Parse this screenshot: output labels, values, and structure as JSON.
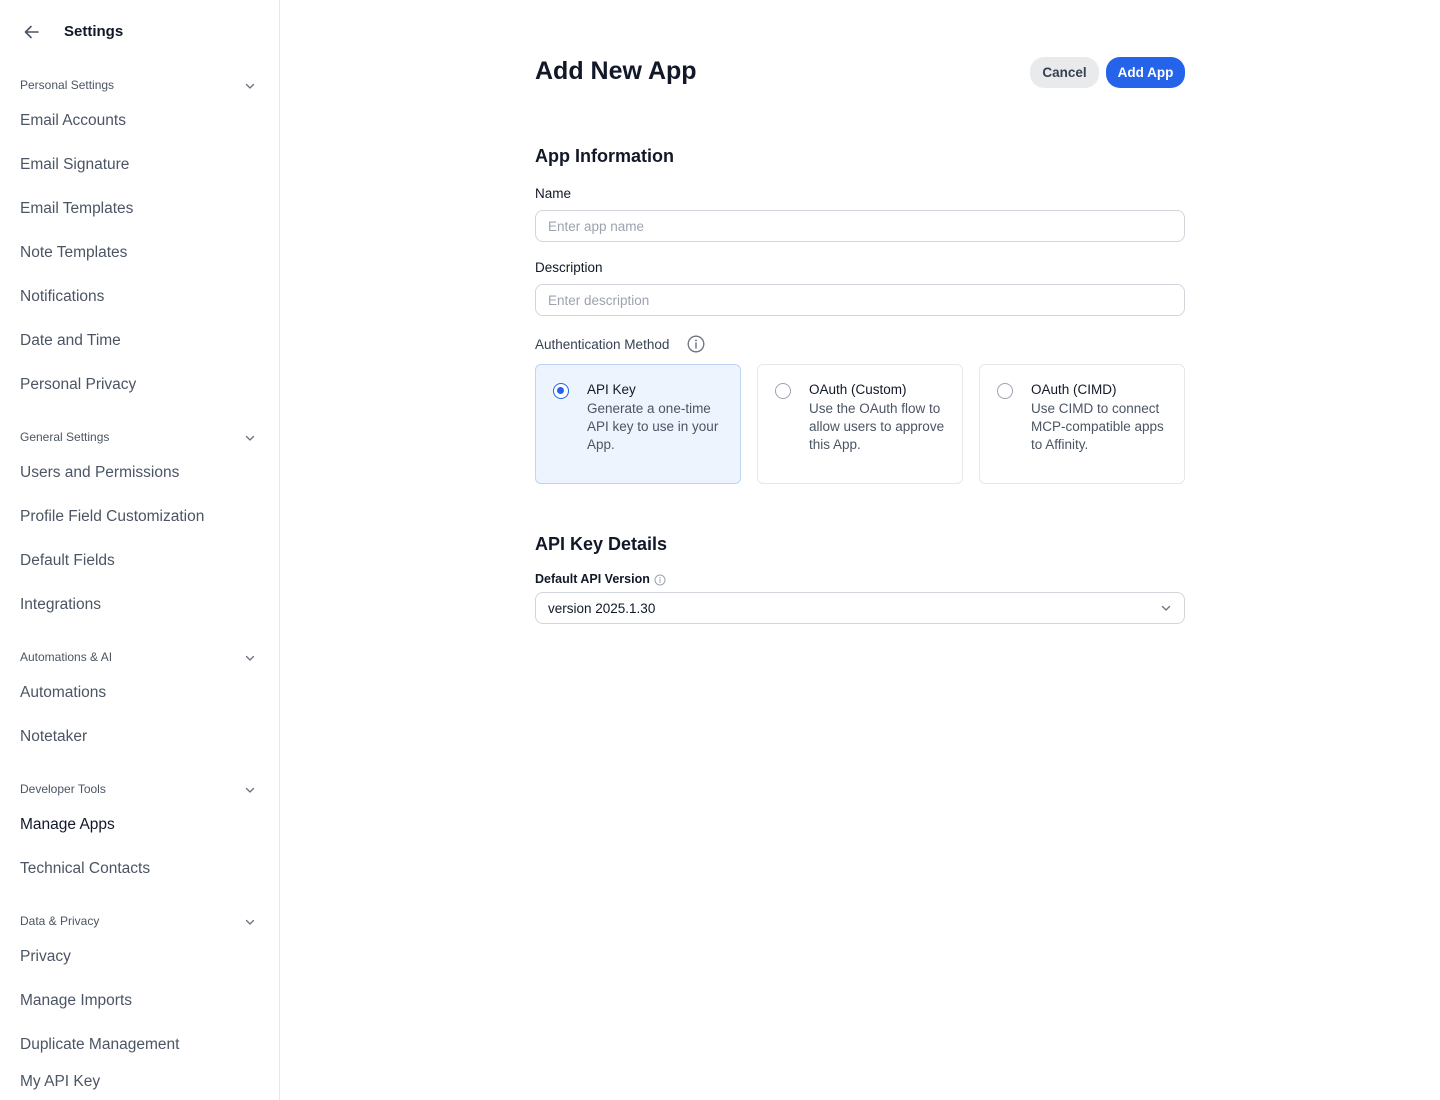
{
  "sidebar": {
    "title": "Settings",
    "sections": [
      {
        "label": "Personal Settings",
        "items": [
          "Email Accounts",
          "Email Signature",
          "Email Templates",
          "Note Templates",
          "Notifications",
          "Date and Time",
          "Personal Privacy"
        ]
      },
      {
        "label": "General Settings",
        "items": [
          "Users and Permissions",
          "Profile Field Customization",
          "Default Fields",
          "Integrations"
        ]
      },
      {
        "label": "Automations & AI",
        "items": [
          "Automations",
          "Notetaker"
        ]
      },
      {
        "label": "Developer Tools",
        "items": [
          "Manage Apps",
          "Technical Contacts"
        ]
      },
      {
        "label": "Data & Privacy",
        "items": [
          "Privacy",
          "Manage Imports",
          "Duplicate Management",
          "My API Key"
        ]
      }
    ],
    "active_item": "Manage Apps"
  },
  "header": {
    "title": "Add New App",
    "cancel_label": "Cancel",
    "add_label": "Add App"
  },
  "app_info": {
    "title": "App Information",
    "name_label": "Name",
    "name_value": "",
    "name_placeholder": "Enter app name",
    "description_label": "Description",
    "description_value": "",
    "description_placeholder": "Enter description",
    "auth_label": "Authentication Method",
    "auth_options": [
      {
        "title": "API Key",
        "description": "Generate a one-time API key to use in your App.",
        "selected": true
      },
      {
        "title": "OAuth (Custom)",
        "description": "Use the OAuth flow to allow users to approve this App.",
        "selected": false
      },
      {
        "title": "OAuth (CIMD)",
        "description": "Use CIMD to connect MCP-compatible apps to Affinity.",
        "selected": false
      }
    ]
  },
  "api_key_details": {
    "title": "API Key Details",
    "version_label": "Default API Version",
    "version_value": "version 2025.1.30"
  },
  "colors": {
    "accent": "#2563eb",
    "selected_card_bg": "#eef4fe",
    "border": "#e5e7eb",
    "text_primary": "#111827",
    "text_secondary": "#4b5563"
  }
}
